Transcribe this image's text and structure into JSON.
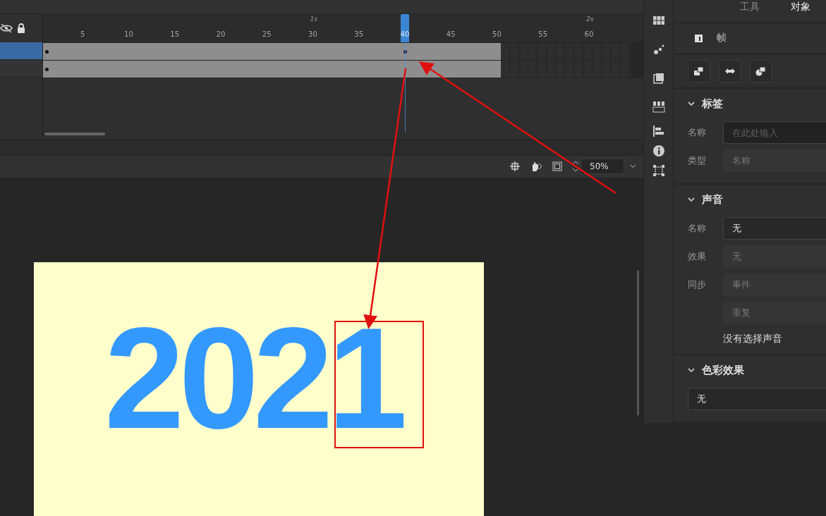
{
  "timeline": {
    "seconds": [
      "1s",
      "2s"
    ],
    "frame_numbers": [
      {
        "label": "5",
        "selected": false
      },
      {
        "label": "10",
        "selected": false
      },
      {
        "label": "15",
        "selected": false
      },
      {
        "label": "20",
        "selected": false
      },
      {
        "label": "25",
        "selected": false
      },
      {
        "label": "30",
        "selected": false
      },
      {
        "label": "35",
        "selected": false
      },
      {
        "label": "40",
        "selected": true
      },
      {
        "label": "45",
        "selected": false
      },
      {
        "label": "50",
        "selected": false
      },
      {
        "label": "55",
        "selected": false
      },
      {
        "label": "60",
        "selected": false
      }
    ],
    "layers": [
      {
        "selected": true
      },
      {
        "selected": false
      }
    ]
  },
  "stage_toolbar": {
    "zoom": "50%"
  },
  "stage": {
    "text": "2021"
  },
  "panel": {
    "tabs": [
      {
        "label": "工具",
        "selected": false
      },
      {
        "label": "对象",
        "selected": true
      }
    ],
    "header": "帧",
    "sections": [
      {
        "title": "标签",
        "expanded": true,
        "rows": [
          {
            "label": "名称",
            "placeholder": "在此处输入",
            "disabled": false
          },
          {
            "label": "类型",
            "value": "名称",
            "disabled": true
          }
        ]
      },
      {
        "title": "声音",
        "expanded": true,
        "rows": [
          {
            "label": "名称",
            "value": "无",
            "disabled": false
          },
          {
            "label": "效果",
            "value": "无",
            "disabled": true
          },
          {
            "label": "同步",
            "value": "事件",
            "disabled": true
          },
          {
            "value": "重复",
            "disabled": true
          }
        ],
        "note": "没有选择声音"
      },
      {
        "title": "色彩效果",
        "expanded": true,
        "rows": [
          {
            "value": "无",
            "disabled": false
          }
        ]
      }
    ]
  }
}
